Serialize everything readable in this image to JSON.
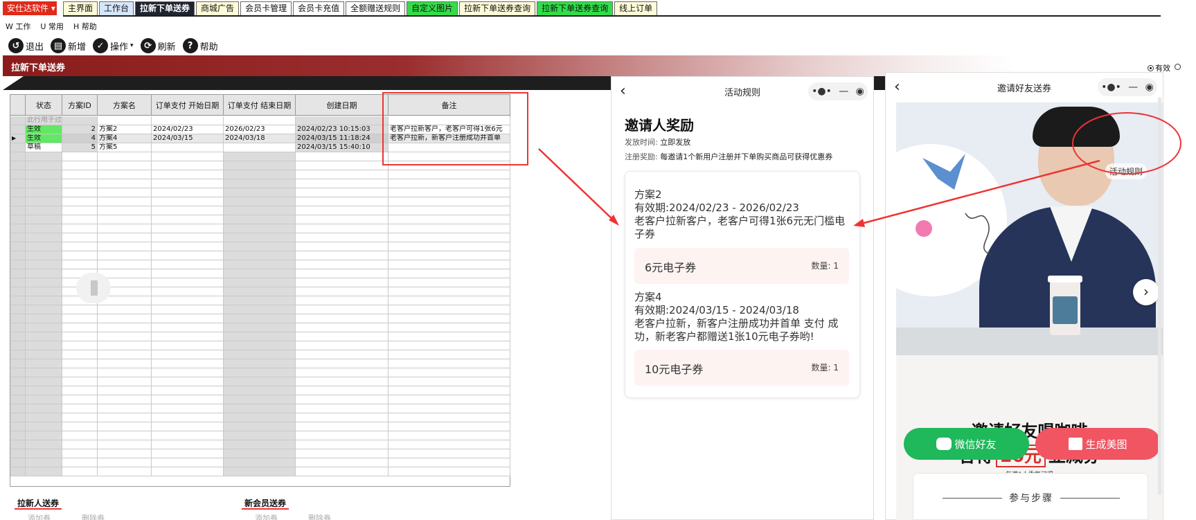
{
  "tabbar": {
    "brand": "安仕达软件",
    "tabs": [
      "主界面",
      "工作台",
      "拉新下单送券",
      "商城广告",
      "会员卡管理",
      "会员卡充值",
      "全额赠送规则",
      "自定义图片",
      "拉新下单送券查询",
      "拉新下单送券查询",
      "线上订单"
    ]
  },
  "menu": [
    "W 工作",
    "U 常用",
    "H 帮助"
  ],
  "toolbar": {
    "exit": "退出",
    "add": "新增",
    "operate": "操作",
    "refresh": "刷新",
    "help": "帮助"
  },
  "title_band": "拉新下单送券",
  "filter": {
    "active_label": "有效",
    "other_label": ""
  },
  "grid": {
    "headers": [
      "状态",
      "方案ID",
      "方案名",
      "订单支付 开始日期",
      "订单支付 结束日期",
      "创建日期",
      "备注"
    ],
    "hint_row": "此行用于过",
    "rows": [
      {
        "status": "生效",
        "id": "2",
        "name": "方案2",
        "start": "2024/02/23",
        "end": "2026/02/23",
        "created": "2024/02/23 10:15:03",
        "note": "老客户拉新客户，老客户可得1张6元"
      },
      {
        "status": "生效",
        "id": "4",
        "name": "方案4",
        "start": "2024/03/15",
        "end": "2024/03/18",
        "created": "2024/03/15 11:18:24",
        "note": "老客户拉新，新客户注册成功并首单"
      },
      {
        "status": "草稿",
        "id": "5",
        "name": "方案5",
        "start": "",
        "end": "",
        "created": "2024/03/15 15:40:10",
        "note": ""
      }
    ]
  },
  "sections": {
    "left_title": "拉新人送券",
    "right_title": "新会员送券",
    "add_label": "添加券",
    "delete_label": "删除券"
  },
  "rules_phone": {
    "title": "活动规则",
    "heading": "邀请人奖励",
    "issue_label": "发放时间:",
    "issue_value": "立即发放",
    "reward_label": "注册奖励:",
    "reward_value": "每邀请1个新用户注册并下单购买商品可获得优惠券",
    "plans": [
      {
        "name": "方案2",
        "period": "有效期:2024/02/23 - 2026/02/23",
        "desc": "老客户拉新客户，老客户可得1张6元无门槛电子券",
        "coupon": "6元电子券",
        "qty": "数量: 1"
      },
      {
        "name": "方案4",
        "period": "有效期:2024/03/15 - 2024/03/18",
        "desc": "老客户拉新，新客户注册成功并首单 支付 成功，新老客户都赠送1张10元电子券哟!",
        "coupon": "10元电子券",
        "qty": "数量: 1"
      }
    ]
  },
  "invite_phone": {
    "title": "邀请好友送券",
    "rules_link": "活动规则",
    "headline1": "邀请好友喝咖啡",
    "headline2_pre": "各得",
    "headline2_amount": "20元",
    "headline2_post": "立减券",
    "tagline": "— 每邀1人重复可得 —",
    "btn_wechat": "微信好友",
    "btn_poster": "生成美图",
    "steps_title": "参与步骤"
  },
  "colors": {
    "accent_red": "#e33333",
    "title_band": "#8b1c1c",
    "status_green": "#61e864",
    "wechat_green": "#1fb85b",
    "poster_red": "#f05561"
  }
}
